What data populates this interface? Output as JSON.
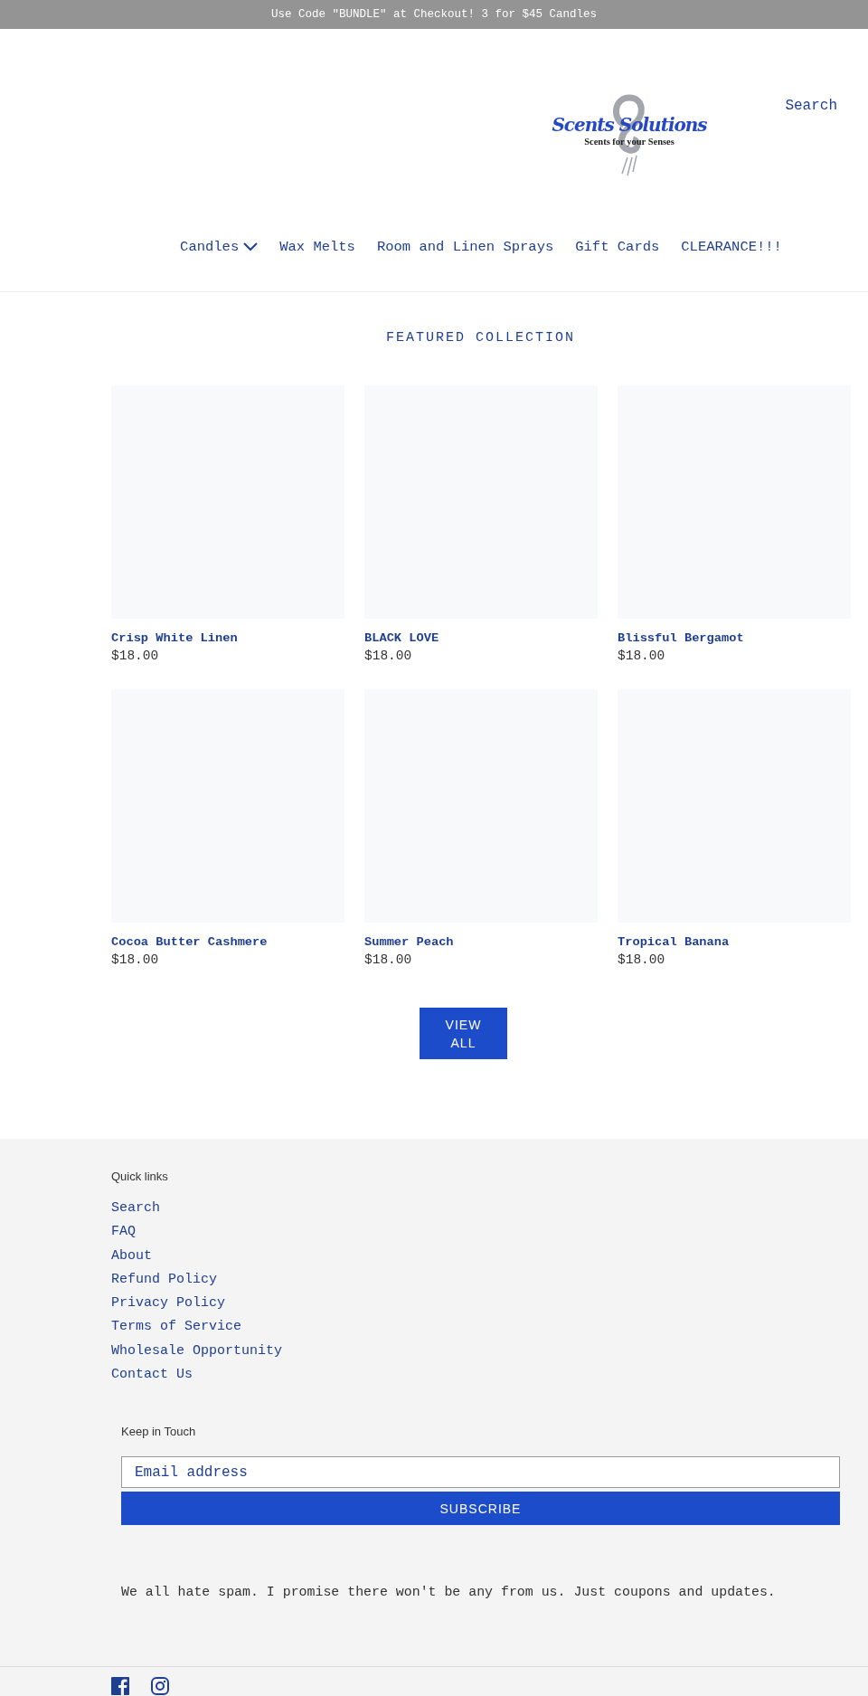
{
  "announcement": "Use Code \"BUNDLE\" at Checkout! 3 for $45 Candles",
  "header": {
    "logo": {
      "title": "Scents Solutions",
      "tagline": "Scents for your Senses"
    },
    "search": "Search",
    "nav": [
      {
        "label": "Candles",
        "has_dropdown": true
      },
      {
        "label": "Wax Melts",
        "has_dropdown": false
      },
      {
        "label": "Room and Linen Sprays",
        "has_dropdown": false
      },
      {
        "label": "Gift Cards",
        "has_dropdown": false
      },
      {
        "label": "CLEARANCE!!!",
        "has_dropdown": false
      }
    ]
  },
  "featured": {
    "title": "FEATURED COLLECTION",
    "products": [
      {
        "name": "Crisp White Linen",
        "price": "$18.00"
      },
      {
        "name": "BLACK LOVE",
        "price": "$18.00"
      },
      {
        "name": "Blissful Bergamot",
        "price": "$18.00"
      },
      {
        "name": "Cocoa Butter Cashmere",
        "price": "$18.00"
      },
      {
        "name": "Summer Peach",
        "price": "$18.00"
      },
      {
        "name": "Tropical Banana",
        "price": "$18.00"
      }
    ],
    "view_all": "VIEW ALL"
  },
  "footer": {
    "quick_links": {
      "title": "Quick links",
      "links": [
        "Search",
        "FAQ",
        "About",
        "Refund Policy",
        "Privacy Policy",
        "Terms of Service",
        "Wholesale Opportunity",
        "Contact Us"
      ]
    },
    "newsletter": {
      "title": "Keep in Touch",
      "placeholder": "Email address",
      "button": "SUBSCRIBE",
      "note": "We all hate spam. I promise there won't be any from us. Just coupons and updates."
    },
    "social": [
      {
        "kind": "facebook"
      },
      {
        "kind": "instagram"
      }
    ]
  }
}
